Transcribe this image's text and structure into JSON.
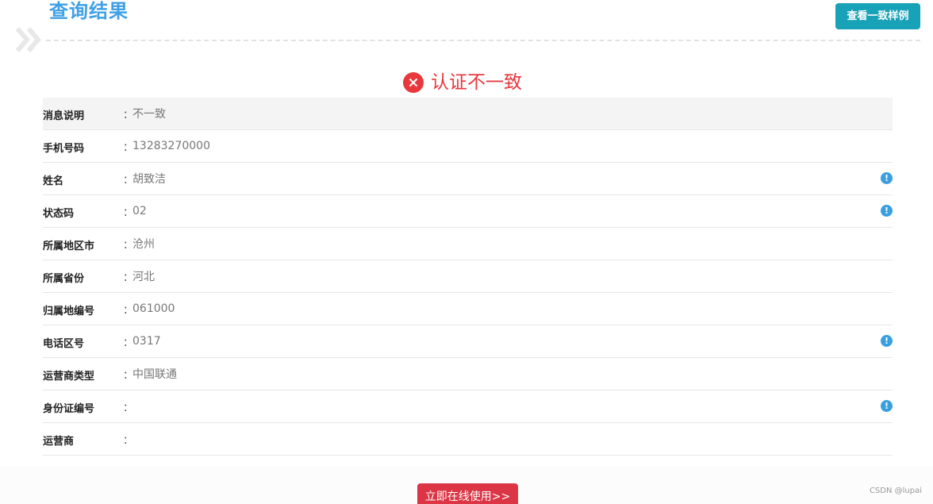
{
  "header": {
    "title": "查询结果",
    "sample_button": "查看一致样例"
  },
  "result": {
    "text": "认证不一致",
    "color": "#e8383d"
  },
  "rows": [
    {
      "label": "消息说明",
      "sep": "：",
      "value": "不一致",
      "info_icon": false
    },
    {
      "label": "手机号码",
      "sep": "：",
      "value": "13283270000",
      "info_icon": false
    },
    {
      "label": "姓名",
      "sep": "：",
      "value": "胡致洁",
      "info_icon": true
    },
    {
      "label": "状态码",
      "sep": "：",
      "value": "02",
      "info_icon": true
    },
    {
      "label": "所属地区市",
      "sep": "：",
      "value": "沧州",
      "info_icon": false
    },
    {
      "label": "所属省份",
      "sep": "：",
      "value": "河北",
      "info_icon": false
    },
    {
      "label": "归属地编号",
      "sep": "：",
      "value": "061000",
      "info_icon": false
    },
    {
      "label": "电话区号",
      "sep": "：",
      "value": "0317",
      "info_icon": true
    },
    {
      "label": "运营商类型",
      "sep": "：",
      "value": "中国联通",
      "info_icon": false
    },
    {
      "label": "身份证编号",
      "sep": "：",
      "value": "",
      "info_icon": true
    },
    {
      "label": "运营商",
      "sep": "：",
      "value": "",
      "info_icon": false
    }
  ],
  "info_icon_glyph": "!",
  "footer": {
    "use_button": "立即在线使用>>",
    "watermark": "CSDN @lupai"
  },
  "colors": {
    "title": "#3fa0e6",
    "sample_button": "#17a2b8",
    "use_button": "#dc3545",
    "info_icon": "#3a9fe0"
  }
}
